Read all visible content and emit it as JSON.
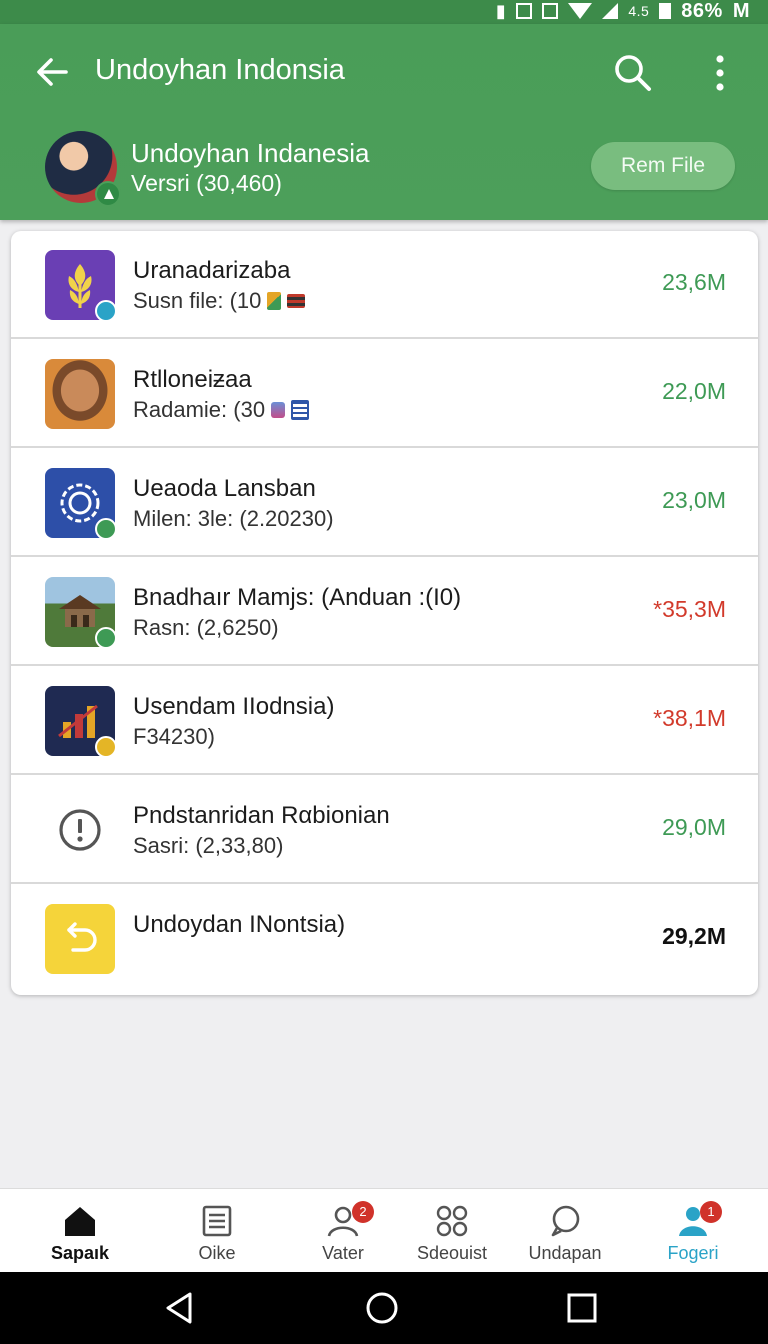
{
  "status_bar": {
    "small_text": "4.5",
    "battery": "86%",
    "carrier": "M"
  },
  "app_bar": {
    "title": "Undoyhan Indonsia"
  },
  "profile": {
    "name": "Undoyhan Indanesia",
    "version": "Versri (30,460)",
    "action_label": "Rem File"
  },
  "colors": {
    "primary": "#4c9f5a",
    "accent_green": "#3e9a55",
    "alert_red": "#d23a2b",
    "active_nav": "#2aa3c7"
  },
  "items": [
    {
      "title": "Uranadarizaba",
      "subtitle": "Susn file: (10",
      "size": "23,6M",
      "size_color": "green",
      "icon": "wheat-app-icon"
    },
    {
      "title": "Rtlloneiƶaa",
      "subtitle": "Radamie: (30",
      "size": "22,0M",
      "size_color": "green",
      "icon": "portrait-app-icon"
    },
    {
      "title": "Ueaoda Lansban",
      "subtitle": "Milen: 3le: (2.20230)",
      "size": "23,0M",
      "size_color": "green",
      "icon": "gear-app-icon"
    },
    {
      "title": "Bnadhaır Mamjs: (Anduan :(I0)",
      "subtitle": "Rasn: (2,6250)",
      "size": "*35,3M",
      "size_color": "red",
      "icon": "pavilion-app-icon"
    },
    {
      "title": "Usendam IIodnsia)",
      "subtitle": "F34230)",
      "size": "*38,1M",
      "size_color": "red",
      "icon": "chart-app-icon"
    },
    {
      "title": "Pndstanridan Rαbionian",
      "subtitle": "Sasri: (2,33,80)",
      "size": "29,0M",
      "size_color": "green",
      "icon": "alert-icon"
    },
    {
      "title": "Undoydan INontsia)",
      "subtitle": "",
      "size": "29,2M",
      "size_color": "black",
      "icon": "return-app-icon"
    }
  ],
  "bottom_nav": [
    {
      "label": "Sapaık",
      "icon": "home-icon",
      "active": true
    },
    {
      "label": "Oike",
      "icon": "document-icon"
    },
    {
      "label": "Vater",
      "icon": "user-icon",
      "badge": "2"
    },
    {
      "label": "Sdeouist",
      "icon": "apps-icon"
    },
    {
      "label": "Undapan",
      "icon": "chat-icon"
    },
    {
      "label": "Fogeri",
      "icon": "profile-icon",
      "badge": "1"
    }
  ]
}
